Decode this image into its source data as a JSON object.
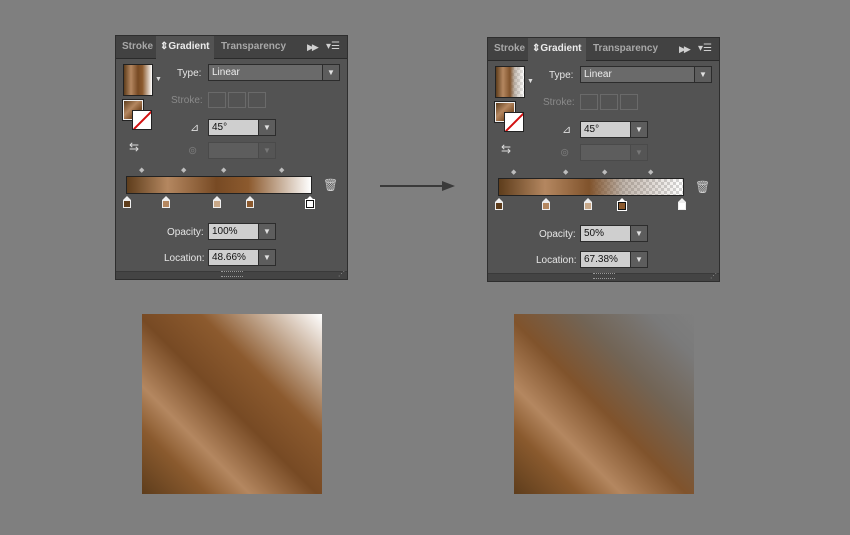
{
  "colors": {
    "background": "#7f7f7f",
    "panel": "#535353",
    "accent_brown": "#8a5a2e"
  },
  "panels": [
    {
      "tabs": [
        "Stroke",
        "Gradient",
        "Transparency"
      ],
      "active_tab": "Gradient",
      "type_label": "Type:",
      "type_value": "Linear",
      "stroke_label": "Stroke:",
      "angle_value": "45°",
      "ratio_value": "",
      "opacity_label": "Opacity:",
      "opacity_value": "100%",
      "location_label": "Location:",
      "location_value": "48.66%",
      "icons": [
        "panel-options-icon",
        "panel-menu-icon",
        "reverse-gradient-icon",
        "angle-icon",
        "aspect-ratio-icon",
        "trash-icon"
      ],
      "stops": [
        {
          "location": 0,
          "color": "#5e3d1c",
          "selected": false
        },
        {
          "location": 22,
          "color": "#b48760",
          "selected": false
        },
        {
          "location": 48.66,
          "color": "#774a24",
          "selected": true
        },
        {
          "location": 66,
          "color": "#8c5a2e",
          "selected": false
        },
        {
          "location": 100,
          "color": "#ffffff",
          "selected": false
        }
      ],
      "stop_opacity": [
        100,
        100,
        100,
        100,
        100
      ]
    },
    {
      "tabs": [
        "Stroke",
        "Gradient",
        "Transparency"
      ],
      "active_tab": "Gradient",
      "type_label": "Type:",
      "type_value": "Linear",
      "stroke_label": "Stroke:",
      "angle_value": "45°",
      "ratio_value": "",
      "opacity_label": "Opacity:",
      "opacity_value": "50%",
      "location_label": "Location:",
      "location_value": "67.38%",
      "icons": [
        "panel-options-icon",
        "panel-menu-icon",
        "reverse-gradient-icon",
        "angle-icon",
        "aspect-ratio-icon",
        "trash-icon"
      ],
      "stops": [
        {
          "location": 0,
          "color": "#5e3d1c",
          "selected": false
        },
        {
          "location": 25,
          "color": "#b48760",
          "selected": false
        },
        {
          "location": 49,
          "color": "#80532c",
          "selected": false
        },
        {
          "location": 67.38,
          "color": "#726455",
          "selected": true
        },
        {
          "location": 100,
          "color": "#ffffff",
          "selected": false
        }
      ],
      "stop_opacity": [
        100,
        100,
        100,
        50,
        0
      ]
    }
  ],
  "arrow_icon": "right-arrow-icon"
}
